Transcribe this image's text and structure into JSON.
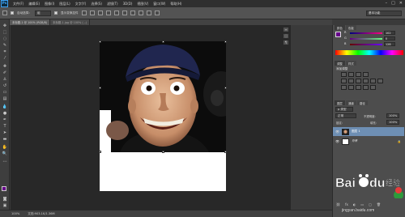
{
  "menubar": {
    "logo": "Ps",
    "items": [
      "文件(F)",
      "编辑(E)",
      "图像(I)",
      "图层(L)",
      "文字(Y)",
      "选择(S)",
      "滤镜(T)",
      "3D(D)",
      "视图(V)",
      "窗口(W)",
      "帮助(H)"
    ],
    "min": "–",
    "max": "□",
    "close": "✕"
  },
  "options": {
    "auto_select_label": "自动选择：",
    "auto_select_value": "组",
    "show_transform_label": "显示变换控件",
    "workspace": "基本功能"
  },
  "document": {
    "tab1": "未标题-1 @ 100% (RGB/8)",
    "tab2": "未标题-1.jpg @ 100% (...)"
  },
  "status": {
    "zoom": "100%",
    "doc_info": "文档:903.1K/1.36M"
  },
  "color_panel": {
    "tabs": [
      "颜色",
      "色板"
    ],
    "r_label": "R",
    "r_value": "102",
    "g_label": "G",
    "g_value": "0",
    "b_label": "B",
    "b_value": "128",
    "fg_color": "#66008a",
    "bg_color": "#ffffff"
  },
  "adjust_panel": {
    "tabs": [
      "调整",
      "样式"
    ],
    "title": "添加调整"
  },
  "layers_panel": {
    "tabs": [
      "图层",
      "通道",
      "路径"
    ],
    "kind_label": "p 类型",
    "blend_mode": "正常",
    "opacity_label": "不透明度:",
    "opacity_value": "100%",
    "lock_label": "锁定:",
    "fill_label": "填充:",
    "fill_value": "100%",
    "layers": [
      {
        "name": "图层 1",
        "visible": true
      },
      {
        "name": "背景",
        "visible": true
      }
    ]
  },
  "watermark": {
    "brand": "Bai du 经验",
    "url": "jingyan.baidu.com"
  }
}
